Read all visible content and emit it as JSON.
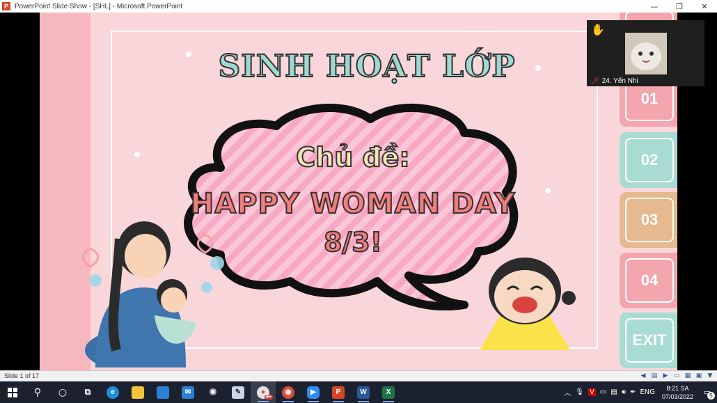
{
  "window": {
    "app_icon": "P",
    "title": "PowerPoint Slide Show - [SHL] - Microsoft PowerPoint",
    "minimize_icon": "minimize-icon",
    "restore_icon": "restore-icon",
    "close_icon": "close-icon"
  },
  "slide": {
    "title": "SINH HOẠT LỚP",
    "topic_label": "Chủ đề:",
    "topic_line1": "HAPPY WOMAN DAY",
    "topic_line2": "8/3!",
    "colors": {
      "background": "#f9d6d9",
      "band": "#f7b7bf",
      "title_fill": "#9fd8d2",
      "topic_red": "#f37d7d"
    }
  },
  "nav": {
    "buttons": [
      {
        "label": "01",
        "color": "#f3a6ad"
      },
      {
        "label": "02",
        "color": "#a8dcd3"
      },
      {
        "label": "03",
        "color": "#e6b98e"
      },
      {
        "label": "04",
        "color": "#f3a6ad"
      },
      {
        "label": "EXIT",
        "color": "#a8dcd3"
      }
    ]
  },
  "video": {
    "participant": "24. Yến Nhi",
    "hand_icon": "raised-hand-icon",
    "mic_icon": "mic-muted-icon"
  },
  "statusbar": {
    "slide_info": "Slide 1 of 17"
  },
  "taskbar": {
    "clock_time": "8:21 SA",
    "clock_date": "07/03/2022",
    "language": "ENG",
    "notification_count": "5",
    "chrome_badge": "9+"
  }
}
